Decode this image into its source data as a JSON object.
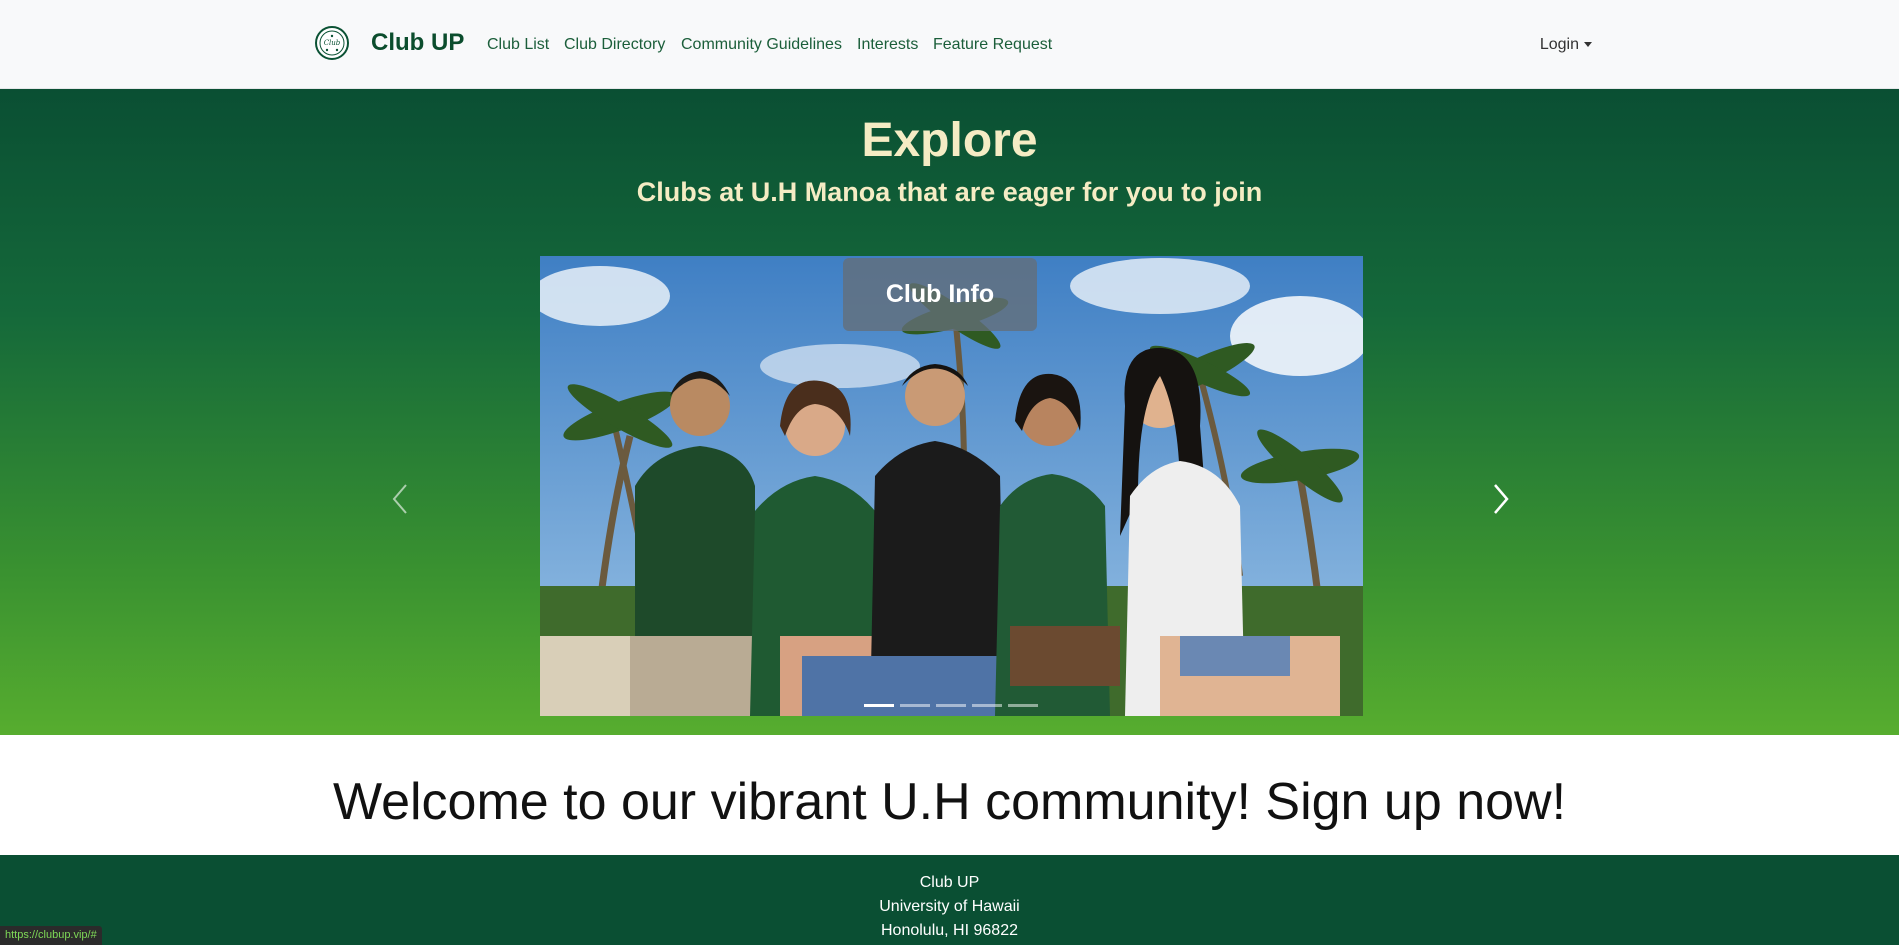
{
  "navbar": {
    "brand": "Club UP",
    "logo_icon": "club-up-logo",
    "links": [
      "Club List",
      "Club Directory",
      "Community Guidelines",
      "Interests",
      "Feature Request"
    ],
    "login": "Login"
  },
  "hero": {
    "title": "Explore",
    "subtitle": "Clubs at U.H Manoa that are eager for you to join",
    "carousel": {
      "caption_button": "Club Info",
      "slide_count": 5,
      "active_slide": 1,
      "prev_icon": "chevron-left-icon",
      "next_icon": "chevron-right-icon"
    }
  },
  "welcome": "Welcome to our vibrant U.H community! Sign up now!",
  "footer": {
    "lines": [
      "Club UP",
      "University of Hawaii",
      "Honolulu, HI 96822"
    ]
  },
  "status_bar": "https://clubup.vip/#",
  "colors": {
    "primary_dark_green": "#0a4f33",
    "bright_green": "#57ad2f",
    "hero_text": "#f5ecc4"
  }
}
